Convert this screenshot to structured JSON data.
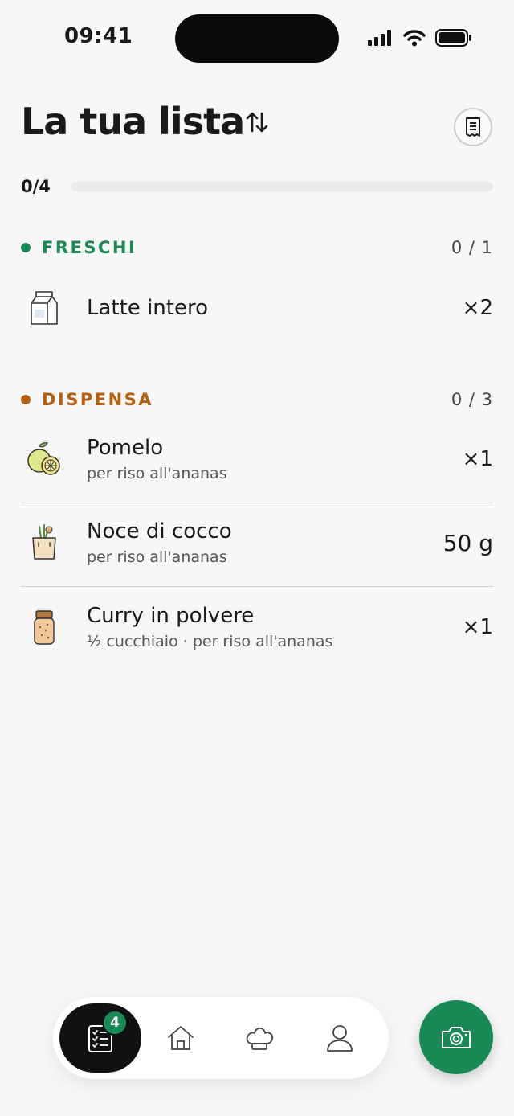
{
  "status_bar": {
    "time": "09:41"
  },
  "header": {
    "title": "La tua lista"
  },
  "progress": {
    "label": "0/4",
    "done": 0,
    "total": 4
  },
  "colors": {
    "accent": "#1a8a55",
    "pantry": "#b5600e",
    "fab": "#1a8a55"
  },
  "sections": [
    {
      "name": "FRESCHI",
      "count": "0 / 1",
      "items": [
        {
          "name": "Latte intero",
          "sub": "",
          "qty": "×2",
          "icon": "milk-carton-icon"
        }
      ]
    },
    {
      "name": "DISPENSA",
      "count": "0 / 3",
      "items": [
        {
          "name": "Pomelo",
          "sub": "per riso all'ananas",
          "qty": "×1",
          "icon": "citrus-icon"
        },
        {
          "name": "Noce di cocco",
          "sub": "per riso all'ananas",
          "qty": "50 g",
          "icon": "grocery-bag-icon"
        },
        {
          "name": "Curry in polvere",
          "sub": "½ cucchiaio · per riso all'ananas",
          "qty": "×1",
          "icon": "spice-jar-icon"
        }
      ]
    }
  ],
  "nav": {
    "badge": "4",
    "items": [
      "checklist-icon",
      "home-icon",
      "chef-hat-icon",
      "profile-icon"
    ]
  }
}
